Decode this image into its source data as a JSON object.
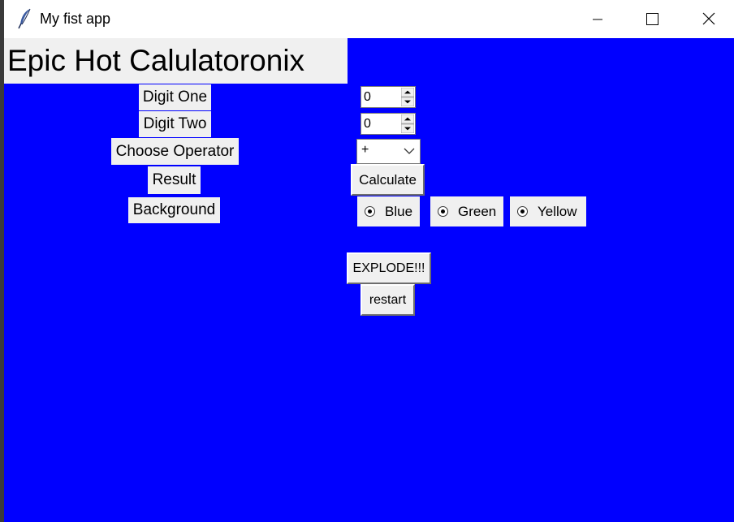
{
  "window": {
    "title": "My fist app"
  },
  "app": {
    "heading": "Epic Hot Calulatoronix",
    "background_color": "#0000ff",
    "labels": {
      "digit_one": "Digit One",
      "digit_two": "Digit Two",
      "choose_operator": "Choose Operator",
      "result": "Result",
      "background": "Background"
    },
    "digit_one_value": "0",
    "digit_two_value": "0",
    "operator_value": "+",
    "calculate_label": "Calculate",
    "background_options": [
      {
        "label": "Blue"
      },
      {
        "label": "Green"
      },
      {
        "label": "Yellow"
      }
    ],
    "explode_label": "EXPLODE!!!",
    "restart_label": "restart"
  },
  "icons": {
    "app": "feather-icon",
    "minimize": "minimize-icon",
    "maximize": "maximize-icon",
    "close": "close-icon"
  }
}
